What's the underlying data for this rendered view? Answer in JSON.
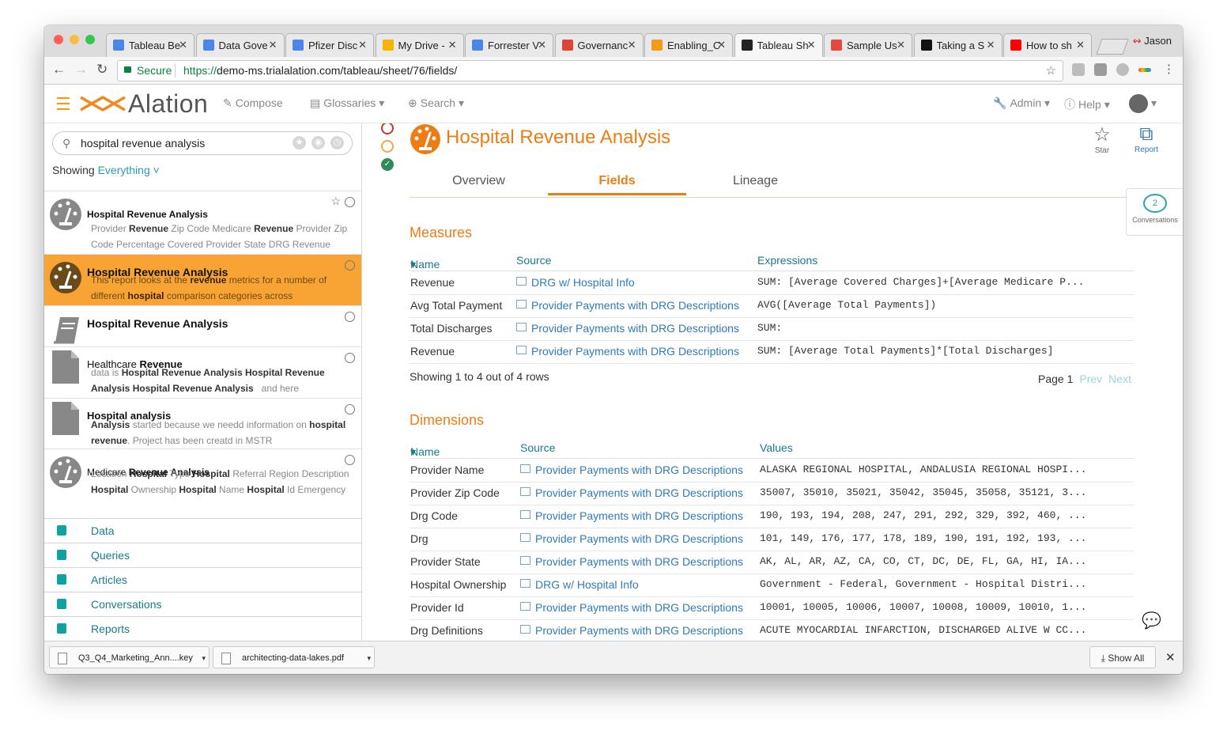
{
  "browser": {
    "tabs": [
      {
        "title": "Tableau Be",
        "icon": "doc-icon",
        "color": "#4a86e8"
      },
      {
        "title": "Data Gove",
        "icon": "doc-icon",
        "color": "#4a86e8"
      },
      {
        "title": "Pfizer Disc",
        "icon": "doc-icon",
        "color": "#4a86e8"
      },
      {
        "title": "My Drive -",
        "icon": "drive-icon",
        "color": "#f4b400"
      },
      {
        "title": "Forrester V",
        "icon": "doc-icon",
        "color": "#4a86e8"
      },
      {
        "title": "Governanc",
        "icon": "pdf-icon",
        "color": "#db4437"
      },
      {
        "title": "Enabling_C",
        "icon": "alation-icon",
        "color": "#f39a1b"
      },
      {
        "title": "Tableau Sh",
        "icon": "alation-dark-icon",
        "color": "#222222"
      },
      {
        "title": "Sample Us",
        "icon": "app-icon",
        "color": "#e04a3f"
      },
      {
        "title": "Taking a S",
        "icon": "github-icon",
        "color": "#111111"
      },
      {
        "title": "How to sh",
        "icon": "youtube-icon",
        "color": "#ff0000"
      }
    ],
    "user": "Jason",
    "secure_label": "Secure",
    "url_proto": "https://",
    "url_rest": "demo-ms.trialalation.com/tableau/sheet/76/fields/"
  },
  "app": {
    "logo": "Alation",
    "nav": {
      "compose": "Compose",
      "glossaries": "Glossaries",
      "search": "Search",
      "admin": "Admin",
      "help": "Help"
    },
    "accent": "#ee7c14"
  },
  "left": {
    "search_value": "hospital revenue analysis",
    "showing_prefix": "Showing",
    "showing_value": "Everything",
    "results": [
      {
        "title": "Hospital Revenue Analysis",
        "desc_html": "Provider <b>Revenue</b> Zip Code Medicare <b>Revenue</b> Provider Zip Code Percentage Covered Provider State DRG Revenue"
      },
      {
        "title": "Hospital Revenue Analysis",
        "desc_html": "This report looks at the <b>revenue</b> metrics for a number of different <b>hospital</b> comparison categories across"
      },
      {
        "title": "Hospital Revenue Analysis",
        "desc_html": ""
      },
      {
        "title_pre": "Healthcare ",
        "title_bold": "Revenue",
        "desc_html": "data is <b>Hospital Revenue Analysis Hospital Revenue Analysis Hospital Revenue Analysis</b> &nbsp; and here"
      },
      {
        "title": "Hospital analysis",
        "desc_html": "<b>Analysis</b> started because we needd information on <b>hospital revenue</b>. Project has been creatd in MSTR"
      },
      {
        "title_pre": "Medicare ",
        "title_bold": "Revenue Analysis",
        "desc_html": "Location <b>Hospital</b> Type <b>Hospital</b> Referral Region Description <b>Hospital</b> Ownership <b>Hospital</b> Name <b>Hospital</b> Id Emergency"
      }
    ],
    "categories": [
      "Data",
      "Queries",
      "Articles",
      "Conversations",
      "Reports"
    ]
  },
  "main": {
    "title": "Hospital Revenue Analysis",
    "star_label": "Star",
    "report_label": "Report",
    "tabs": [
      "Overview",
      "Fields",
      "Lineage"
    ],
    "conversations_count": "2",
    "conversations_label": "Conversations",
    "measures": {
      "heading": "Measures",
      "cols": [
        "Name",
        "Source",
        "Expressions"
      ],
      "rows": [
        {
          "name": "Revenue",
          "source": "DRG w/ Hospital Info",
          "expr": "SUM: [Average Covered Charges]+[Average Medicare P..."
        },
        {
          "name": "Avg Total Payment",
          "source": "Provider Payments with DRG Descriptions",
          "expr": "AVG([Average Total Payments])"
        },
        {
          "name": "Total Discharges",
          "source": "Provider Payments with DRG Descriptions",
          "expr": "SUM:"
        },
        {
          "name": "Revenue",
          "source": "Provider Payments with DRG Descriptions",
          "expr": "SUM: [Average Total Payments]*[Total Discharges]"
        }
      ],
      "showing": "Showing 1 to 4 out of 4 rows",
      "page": "Page 1",
      "prev": "Prev",
      "next": "Next"
    },
    "dimensions": {
      "heading": "Dimensions",
      "cols": [
        "Name",
        "Source",
        "Values"
      ],
      "rows": [
        {
          "name": "Provider Name",
          "source": "Provider Payments with DRG Descriptions",
          "expr": "ALASKA REGIONAL HOSPITAL, ANDALUSIA REGIONAL HOSPI..."
        },
        {
          "name": "Provider Zip Code",
          "source": "Provider Payments with DRG Descriptions",
          "expr": "35007, 35010, 35021, 35042, 35045, 35058, 35121, 3..."
        },
        {
          "name": "Drg Code",
          "source": "Provider Payments with DRG Descriptions",
          "expr": "190, 193, 194, 208, 247, 291, 292, 329, 392, 460, ..."
        },
        {
          "name": "Drg",
          "source": "Provider Payments with DRG Descriptions",
          "expr": "101, 149, 176, 177, 178, 189, 190, 191, 192, 193, ..."
        },
        {
          "name": "Provider State",
          "source": "Provider Payments with DRG Descriptions",
          "expr": "AK, AL, AR, AZ, CA, CO, CT, DC, DE, FL, GA, HI, IA..."
        },
        {
          "name": "Hospital Ownership",
          "source": "DRG w/ Hospital Info",
          "expr": "Government - Federal, Government - Hospital Distri..."
        },
        {
          "name": "Provider Id",
          "source": "Provider Payments with DRG Descriptions",
          "expr": "10001, 10005, 10006, 10007, 10008, 10009, 10010, 1..."
        },
        {
          "name": "Drg Definitions",
          "source": "Provider Payments with DRG Descriptions",
          "expr": "ACUTE MYOCARDIAL INFARCTION, DISCHARGED ALIVE W CC..."
        }
      ]
    }
  },
  "downloads": {
    "files": [
      "Q3_Q4_Marketing_Ann....key",
      "architecting-data-lakes.pdf"
    ],
    "show_all": "Show All"
  }
}
